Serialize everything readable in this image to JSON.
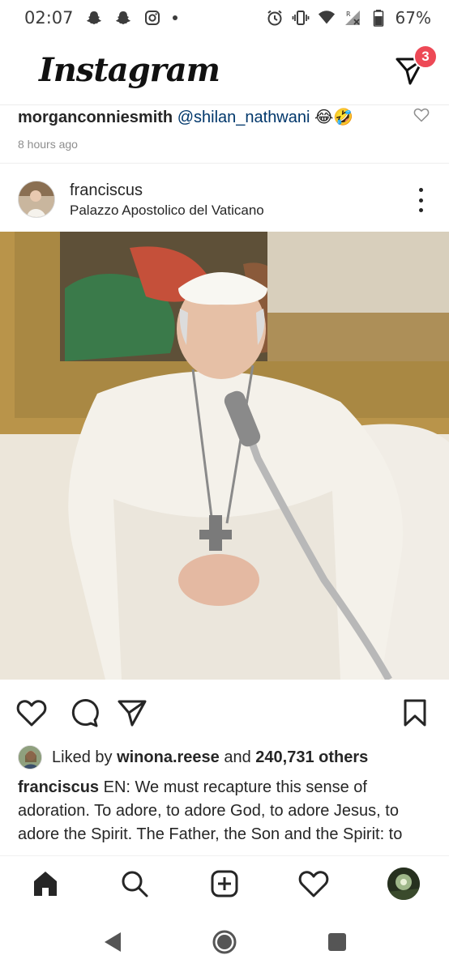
{
  "status_bar": {
    "time": "02:07",
    "battery": "67%",
    "icons": [
      "snapchat-icon",
      "snapchat-icon",
      "instagram-icon",
      "dot-icon",
      "alarm-icon",
      "vibrate-icon",
      "wifi-icon",
      "signal-icon",
      "battery-icon"
    ]
  },
  "header": {
    "logo": "Instagram",
    "dm_badge": "3"
  },
  "previous_comment": {
    "username": "morganconniesmith",
    "mention": "@shilan_nathwani",
    "emoji": "😂🤣",
    "time": "8 hours ago"
  },
  "post": {
    "username": "franciscus",
    "location": "Palazzo Apostolico del Vaticano",
    "liked_by_prefix": "Liked by",
    "liked_by_user": "winona.reese",
    "liked_by_and": "and",
    "liked_by_others": "240,731 others",
    "caption_user": "franciscus",
    "caption_text": "EN: We must recapture this sense of adoration. To adore, to adore God, to adore Jesus, to adore the Spirit. The Father, the Son and the Spirit: to adore. In silence. The sense of adoration. In the"
  },
  "colors": {
    "badge": "#ed4956",
    "mention": "#00376b",
    "text": "#262626",
    "muted": "#8e8e8e"
  }
}
